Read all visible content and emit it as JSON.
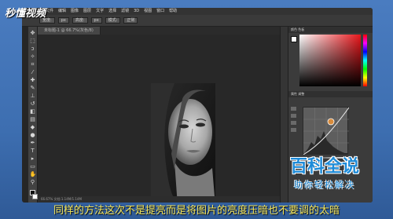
{
  "logo_text": "秒懂视频",
  "app": {
    "menu": [
      "文件",
      "编辑",
      "图像",
      "图层",
      "文字",
      "选择",
      "滤镜",
      "3D",
      "视图",
      "窗口",
      "帮助"
    ],
    "options": [
      "宽度:",
      "px",
      "高度:",
      "px",
      "模式:",
      "正常"
    ],
    "doc_tab": "未标题-1 @ 66.7%(灰色/8)",
    "status": "66.67%   文档:1.14M/1.14M",
    "panel_tabs": "颜色  色板",
    "adjust_tab": "属性  调整"
  },
  "brand": {
    "title": "百科全说",
    "subtitle": "助你轻松解决",
    "color": "#1e8bd8"
  },
  "subtitle": "同样的方法这次不是提亮而是将图片的亮度压暗也不要调的太暗"
}
